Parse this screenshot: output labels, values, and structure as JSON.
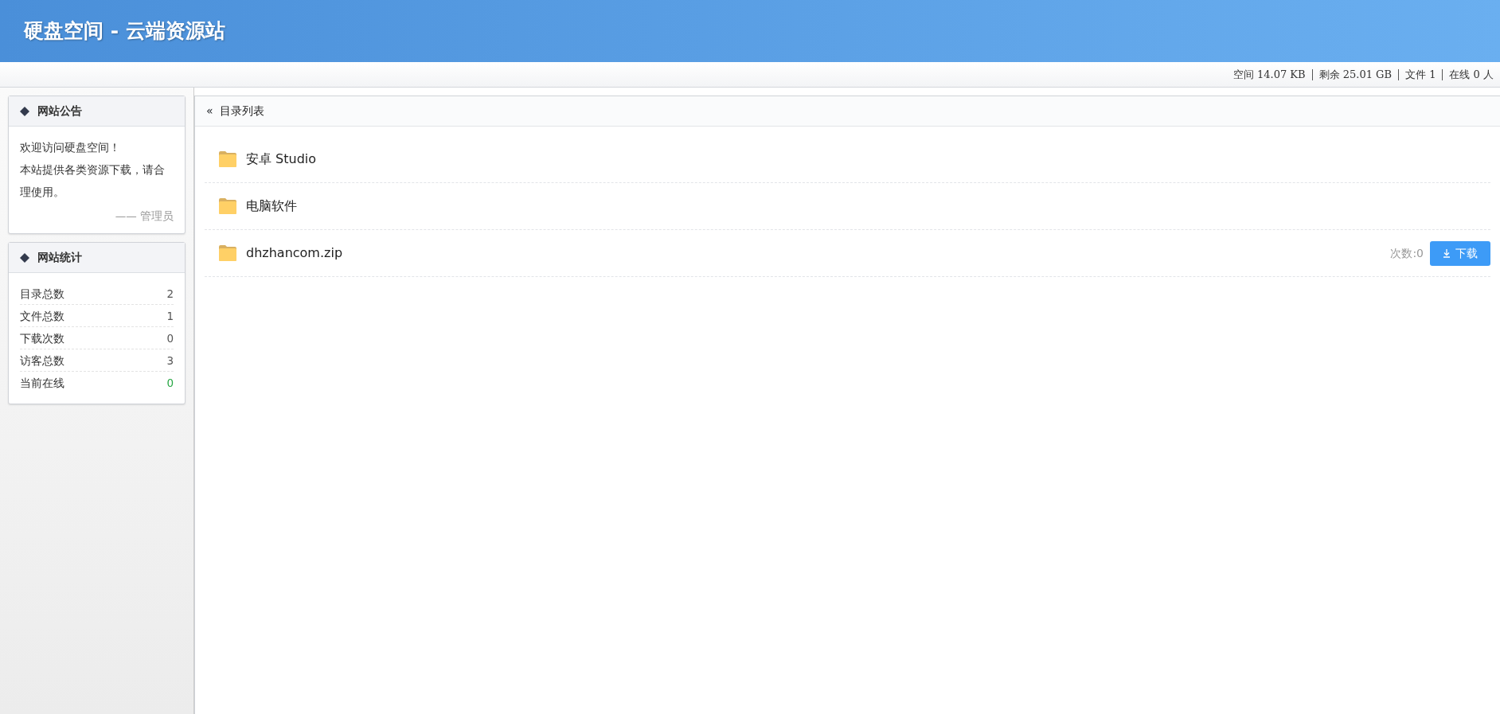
{
  "header": {
    "title": "硬盘空间 - 云端资源站"
  },
  "status_bar": [
    "空间 14.07 KB",
    "剩余 25.01 GB",
    "文件 1",
    "在线 0 人"
  ],
  "notice": {
    "title": "网站公告",
    "lines": [
      "欢迎访问硬盘空间！",
      "本站提供各类资源下载，请合理使用。"
    ],
    "signature": "—— 管理员"
  },
  "stats": {
    "title": "网站统计",
    "items": [
      {
        "label": "目录总数",
        "value": "2",
        "color": "#555555"
      },
      {
        "label": "文件总数",
        "value": "1",
        "color": "#555555"
      },
      {
        "label": "下载次数",
        "value": "0",
        "color": "#555555"
      },
      {
        "label": "访客总数",
        "value": "3",
        "color": "#555555"
      },
      {
        "label": "当前在线",
        "value": "0",
        "color": "#28a745"
      }
    ]
  },
  "listing": {
    "back": "«",
    "title": "目录列表",
    "entries": [
      {
        "kind": "folder",
        "name": "安卓 Studio"
      },
      {
        "kind": "folder",
        "name": "电脑软件"
      },
      {
        "kind": "file",
        "name": "dhzhancom.zip",
        "count": "次数:0",
        "button": "下载"
      }
    ]
  }
}
